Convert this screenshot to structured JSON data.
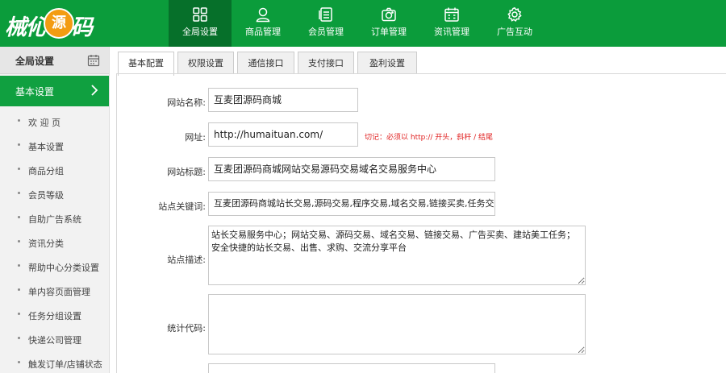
{
  "logo": {
    "text_left": "械伈",
    "text_circle": "源",
    "text_right": "码"
  },
  "nav": [
    {
      "label": "全局设置",
      "icon": "grid-icon"
    },
    {
      "label": "商品管理",
      "icon": "user-icon"
    },
    {
      "label": "会员管理",
      "icon": "document-icon"
    },
    {
      "label": "订单管理",
      "icon": "camera-icon"
    },
    {
      "label": "资讯管理",
      "icon": "calendar-icon"
    },
    {
      "label": "广告互动",
      "icon": "gear-icon"
    }
  ],
  "sidebar": {
    "header": "全局设置",
    "section": "基本设置",
    "items": [
      {
        "label": "欢 迎 页"
      },
      {
        "label": "基本设置"
      },
      {
        "label": "商品分组"
      },
      {
        "label": "会员等级"
      },
      {
        "label": "自助广告系统"
      },
      {
        "label": "资讯分类"
      },
      {
        "label": "帮助中心分类设置"
      },
      {
        "label": "单内容页面管理"
      },
      {
        "label": "任务分组设置"
      },
      {
        "label": "快递公司管理"
      },
      {
        "label": "触发订单/店铺状态"
      }
    ]
  },
  "tabs": [
    {
      "label": "基本配置"
    },
    {
      "label": "权限设置"
    },
    {
      "label": "通信接口"
    },
    {
      "label": "支付接口"
    },
    {
      "label": "盈利设置"
    }
  ],
  "form": {
    "site_name": {
      "label": "网站名称:",
      "value": "互麦团源码商城"
    },
    "url": {
      "label": "网址:",
      "value": "http://humaituan.com/",
      "hint": "切记：必须以 http:// 开头，斜杆 / 结尾"
    },
    "title": {
      "label": "网站标题:",
      "value": "互麦团源码商城网站交易源码交易域名交易服务中心"
    },
    "keywords": {
      "label": "站点关键词:",
      "value": "互麦团源码商城站长交易,源码交易,程序交易,域名交易,链接买卖,任务交"
    },
    "description": {
      "label": "站点描述:",
      "value": "站长交易服务中心；网站交易、源码交易、域名交易、链接交易、广告买卖、建站美工任务；安全快捷的站长交易、出售、求购、交流分享平台"
    },
    "stats": {
      "label": "统计代码:",
      "value": ""
    }
  }
}
